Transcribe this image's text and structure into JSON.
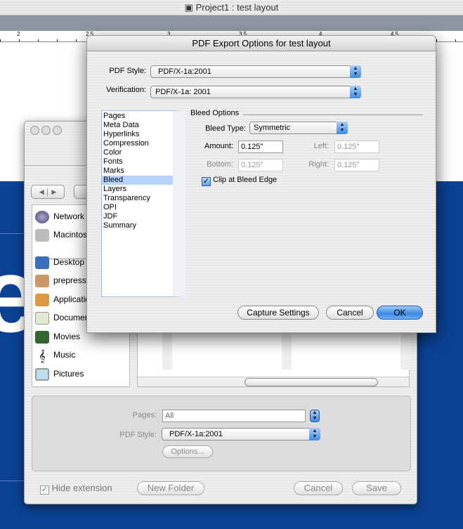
{
  "app": {
    "window_title": "Project1 : test layout",
    "ruler_ticks": [
      "2",
      "2.5",
      "3",
      "3.5",
      "4",
      "4.5"
    ]
  },
  "export_dialog": {
    "title": "PDF Export Options for test layout",
    "pdf_style_label": "PDF Style:",
    "pdf_style_value": "PDF/X-1a:2001",
    "verification_label": "Verification:",
    "verification_value": "PDF/X-1a: 2001",
    "categories": [
      "Pages",
      "Meta Data",
      "Hyperlinks",
      "Compression",
      "Color",
      "Fonts",
      "Marks",
      "Bleed",
      "Layers",
      "Transparency",
      "OPI",
      "JDF",
      "Summary"
    ],
    "selected_category": "Bleed",
    "bleed": {
      "group_title": "Bleed Options",
      "type_label": "Bleed Type:",
      "type_value": "Symmetric",
      "amount_label": "Amount:",
      "amount_value": "0.125\"",
      "left_label": "Left:",
      "left_value": "0.125\"",
      "bottom_label": "Bottom:",
      "bottom_value": "0.125\"",
      "right_label": "Right:",
      "right_value": "0.125\"",
      "clip_label": "Clip at Bleed Edge",
      "clip_checked": true
    },
    "buttons": {
      "capture": "Capture Settings",
      "cancel": "Cancel",
      "ok": "OK"
    }
  },
  "save_dialog": {
    "sidebar": [
      "Network",
      "Macintosh HD",
      "Desktop",
      "prepress",
      "Applications",
      "Documents",
      "Movies",
      "Music",
      "Pictures"
    ],
    "pages_label": "Pages:",
    "pages_value": "All",
    "pdf_style_label": "PDF Style:",
    "pdf_style_value": "PDF/X-1a:2001",
    "options_button": "Options...",
    "hide_extension_label": "Hide extension",
    "new_folder": "New Folder",
    "cancel": "Cancel",
    "save": "Save"
  }
}
